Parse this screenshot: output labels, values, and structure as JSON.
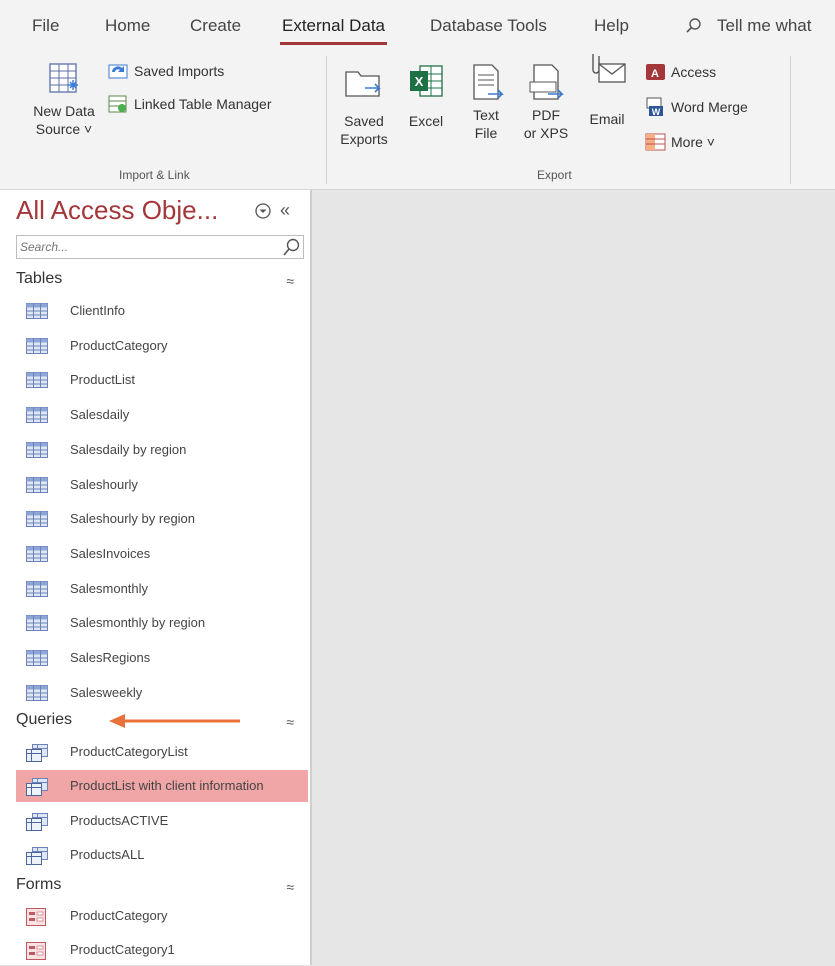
{
  "menu": {
    "tabs": [
      "File",
      "Home",
      "Create",
      "External Data",
      "Database Tools",
      "Help"
    ],
    "active_tab": "External Data",
    "tell_me": "Tell me what"
  },
  "ribbon": {
    "import_link": {
      "label": "Import & Link",
      "new_data_source": "New Data\nSource ˅",
      "saved_imports": "Saved Imports",
      "linked_table_manager": "Linked Table Manager"
    },
    "export": {
      "label": "Export",
      "saved_exports": "Saved\nExports",
      "excel": "Excel",
      "text_file": "Text\nFile",
      "pdf_xps": "PDF\nor XPS",
      "email": "Email",
      "access": "Access",
      "word_merge": "Word Merge",
      "more": "More ˅"
    }
  },
  "nav": {
    "title": "All Access Obje...",
    "search_placeholder": "Search...",
    "tables_header": "Tables",
    "tables": [
      "ClientInfo",
      "ProductCategory",
      "ProductList",
      "Salesdaily",
      "Salesdaily by region",
      "Saleshourly",
      "Saleshourly by region",
      "SalesInvoices",
      "Salesmonthly",
      "Salesmonthly by region",
      "SalesRegions",
      "Salesweekly"
    ],
    "queries_header": "Queries",
    "queries": [
      "ProductCategoryList",
      "ProductList with client information",
      "ProductsACTIVE",
      "ProductsALL"
    ],
    "selected_query": "ProductList with client information",
    "forms_header": "Forms",
    "forms": [
      "ProductCategory",
      "ProductCategory1"
    ]
  },
  "colors": {
    "accent": "#a4373a",
    "selected_bg": "#f0a5a7",
    "annotation_arrow": "#e8723a"
  }
}
